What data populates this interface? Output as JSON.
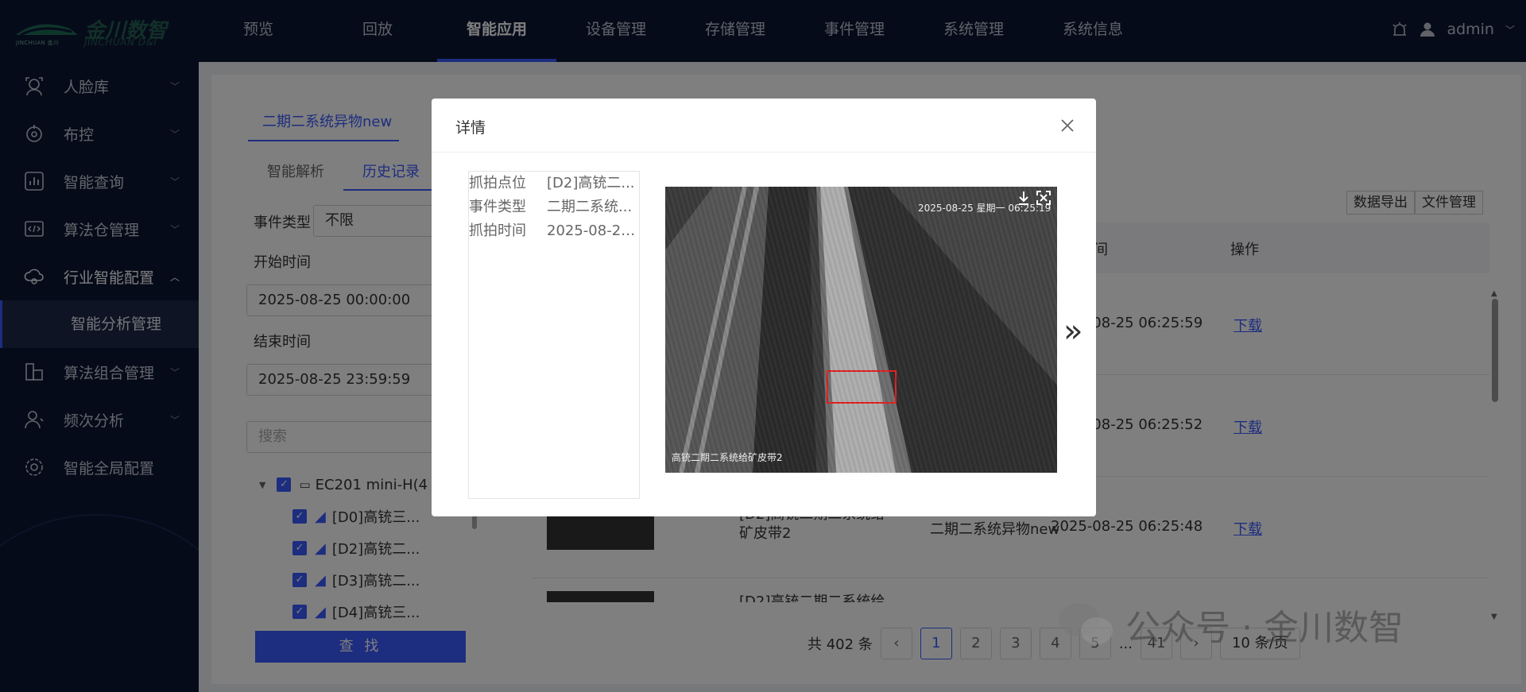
{
  "brand": {
    "cn": "金川数智",
    "en_sub": "JINCHUAN D&I",
    "en_small": "JINCHUAN 金川"
  },
  "nav": [
    "预览",
    "回放",
    "智能应用",
    "设备管理",
    "存储管理",
    "事件管理",
    "系统管理",
    "系统信息"
  ],
  "nav_active": "智能应用",
  "user": {
    "name": "admin"
  },
  "sidebar": {
    "items": [
      {
        "label": "人脸库",
        "icon": "face-icon"
      },
      {
        "label": "布控",
        "icon": "deploy-icon"
      },
      {
        "label": "智能查询",
        "icon": "chart-icon"
      },
      {
        "label": "算法仓管理",
        "icon": "code-icon"
      },
      {
        "label": "行业智能配置",
        "icon": "cloud-icon",
        "expanded": true
      },
      {
        "label": "算法组合管理",
        "icon": "puzzle-icon"
      },
      {
        "label": "频次分析",
        "icon": "person-icon"
      },
      {
        "label": "智能全局配置",
        "icon": "gear-icon"
      }
    ],
    "sub_item": "智能分析管理"
  },
  "content": {
    "top_tab": "二期二系统异物new",
    "subtabs": [
      "智能解析",
      "历史记录"
    ],
    "event_type_label": "事件类型",
    "event_type_value": "不限",
    "start_label": "开始时间",
    "start_value": "2025-08-25 00:00:00",
    "end_label": "结束时间",
    "end_value": "2025-08-25 23:59:59",
    "search_placeholder": "搜索",
    "tree": {
      "root": "EC201 mini-H(4",
      "children": [
        "[D0]高铳三...",
        "[D2]高铳二...",
        "[D3]高铳二...",
        "[D4]高铳三..."
      ]
    },
    "find_button": "查 找",
    "export_button": "数据导出",
    "file_button": "文件管理",
    "table": {
      "headers": {
        "time": "发生时间",
        "action": "操作"
      },
      "rows": [
        {
          "time": "2025-08-25 06:25:59",
          "action": "下载"
        },
        {
          "time": "2025-08-25 06:25:52",
          "action": "下载"
        },
        {
          "name": "[D2]高铳二期二系统给矿皮带2",
          "category": "二期二系统异物new",
          "time": "2025-08-25 06:25:48",
          "action": "下载"
        },
        {
          "name": "[D2]高铳二期二系统给矿皮"
        }
      ]
    },
    "pager": {
      "total": "共 402 条",
      "pages": [
        "1",
        "2",
        "3",
        "4",
        "5",
        "...",
        "41"
      ],
      "current": "1",
      "page_size": "10 条/页"
    }
  },
  "modal": {
    "title": "详情",
    "fields": [
      {
        "key": "抓拍点位",
        "value": "[D2]高铳二..."
      },
      {
        "key": "事件类型",
        "value": "二期二系统..."
      },
      {
        "key": "抓拍时间",
        "value": "2025-08-25..."
      }
    ],
    "photo": {
      "timestamp": "2025-08-25 星期一 06:25:19",
      "caption": "高铳二期二系统给矿皮带2"
    }
  },
  "watermark": "公众号 · 金川数智"
}
